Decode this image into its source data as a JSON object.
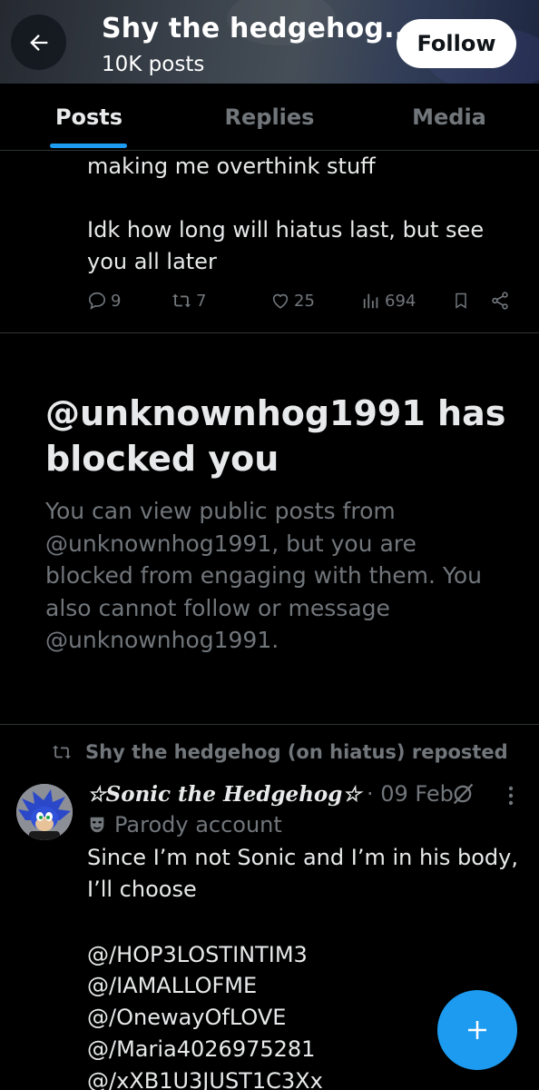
{
  "header": {
    "title": "Shy the hedgehog...",
    "post_count": "10K posts",
    "follow_label": "Follow",
    "back_icon": "arrow-left-icon"
  },
  "tabs": [
    {
      "label": "Posts",
      "active": true
    },
    {
      "label": "Replies",
      "active": false
    },
    {
      "label": "Media",
      "active": false
    }
  ],
  "first_post": {
    "lines": [
      "making me overthink stuff",
      "",
      "Idk how long will hiatus last, but see",
      "you all later"
    ],
    "replies": "9",
    "reposts": "7",
    "likes": "25",
    "views": "694"
  },
  "blocked": {
    "title": "@unknownhog1991 has blocked you",
    "body": "You can view public posts from @unknownhog1991, but you are blocked from engaging with them. You also cannot follow or message @unknownhog1991."
  },
  "repost": {
    "label": "Shy the hedgehog (on hiatus) reposted",
    "author": "☆Sonic the Hedgehog☆",
    "date": "· 09 Feb",
    "badge": "Parody account",
    "lines": [
      "Since I’m not Sonic and I’m in his body,",
      "I’ll choose",
      "",
      "@/HOP3LOSTINTIM3",
      "@/IAMALLOFME",
      "@/OnewayOfLOVE",
      "@/Maria4026975281",
      "@/xXB1U3JUST1C3Xx"
    ]
  },
  "colors": {
    "accent": "#1d9bf0",
    "muted": "#71767b",
    "text": "#e7e9ea",
    "divider": "#2f3336"
  },
  "fab": {
    "icon": "plus-icon"
  }
}
